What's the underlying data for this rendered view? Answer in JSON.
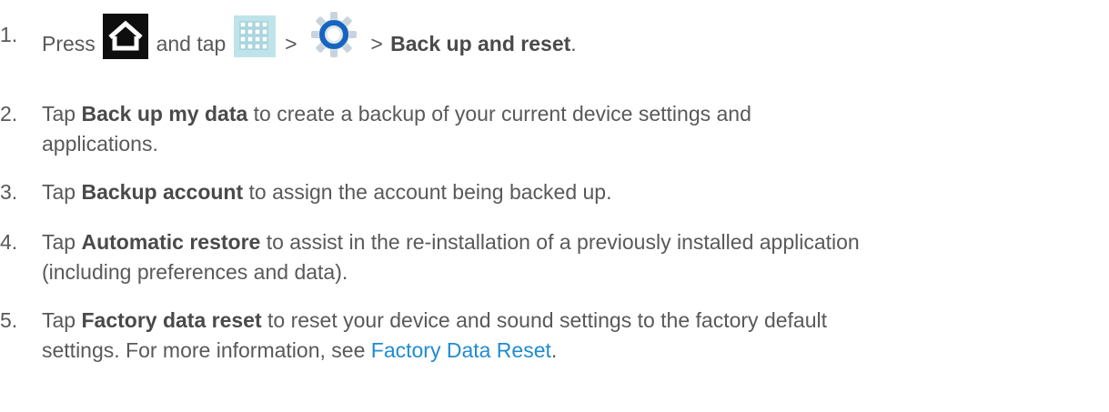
{
  "steps": [
    {
      "num": "1.",
      "press": "Press",
      "and_tap": "and tap",
      "gt1": ">",
      "gt2": ">",
      "target": "Back up and reset",
      "end": ".",
      "icons": [
        "home-icon",
        "apps-icon",
        "settings-gear-icon"
      ]
    },
    {
      "num": "2.",
      "pre": "Tap",
      "bold": "Back up my data",
      "line1": "to create a backup of your current device settings and",
      "line2": "applications."
    },
    {
      "num": "3.",
      "pre": "Tap",
      "bold": "Backup account",
      "line1": "to assign the account being backed up."
    },
    {
      "num": "4.",
      "pre": "Tap",
      "bold": "Automatic restore",
      "line1": "to assist in the re-installation of a previously installed application",
      "line2": "(including preferences and data)."
    },
    {
      "num": "5.",
      "pre": "Tap",
      "bold": "Factory data reset",
      "line1": "to reset your device and sound settings to the factory default",
      "line2": "settings. For more information, see",
      "link": "Factory Data Reset",
      "end": "."
    }
  ],
  "colors": {
    "text": "#595959",
    "link": "#1f8ccf",
    "home_icon_bg": "#0e0e0e",
    "apps_icon_bg": "#bfe3ea",
    "gear_ring": "#1565c0"
  }
}
